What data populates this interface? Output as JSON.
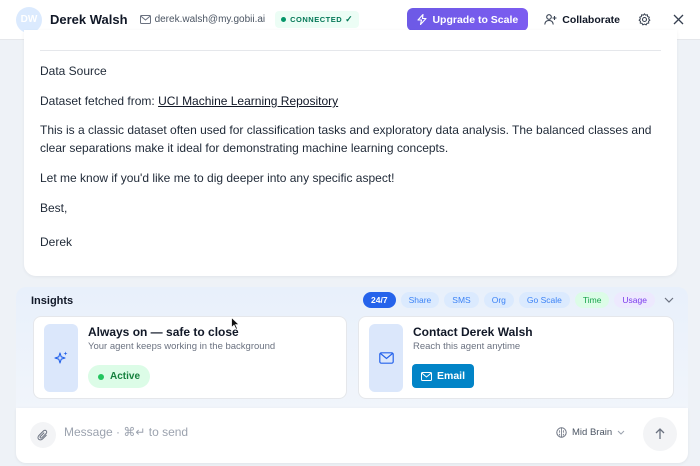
{
  "header": {
    "avatar_initials": "DW",
    "user_name": "Derek Walsh",
    "email": "derek.walsh@my.gobii.ai",
    "status": "CONNECTED",
    "status_check": "✓",
    "upgrade_label": "Upgrade to Scale",
    "collaborate_label": "Collaborate",
    "icons": [
      "mail-icon",
      "bolt-icon",
      "user-plus-icon",
      "gear-icon",
      "close-icon"
    ]
  },
  "message": {
    "heading": "Data Source",
    "dataset_prefix": "Dataset fetched from: ",
    "dataset_link": "UCI Machine Learning Repository",
    "paragraph": "This is a classic dataset often used for classification tasks and exploratory data analysis. The balanced classes and clear separations make it ideal for demonstrating machine learning concepts.",
    "followup": "Let me know if you'd like me to dig deeper into any specific aspect!",
    "signoff": "Best,",
    "signature": "Derek"
  },
  "insights": {
    "title": "Insights",
    "chips": [
      {
        "label": "24/7",
        "style": "active"
      },
      {
        "label": "Share",
        "style": "blue"
      },
      {
        "label": "SMS",
        "style": "blue"
      },
      {
        "label": "Org",
        "style": "blue"
      },
      {
        "label": "Go Scale",
        "style": "blue"
      },
      {
        "label": "Time",
        "style": "green"
      },
      {
        "label": "Usage",
        "style": "purple"
      }
    ],
    "always_on": {
      "title": "Always on — safe to close",
      "subtitle": "Your agent keeps working in the background",
      "badge": "Active"
    },
    "contact": {
      "title": "Contact Derek Walsh",
      "subtitle": "Reach this agent anytime",
      "button": "Email"
    }
  },
  "composer": {
    "placeholder": "Message · ⌘↵ to send",
    "value": "",
    "model": "Mid Brain"
  },
  "colors": {
    "accent": "#6d5ae6",
    "chip_active": "#2563eb",
    "email_button": "#0284c7",
    "connected": "#047857"
  }
}
